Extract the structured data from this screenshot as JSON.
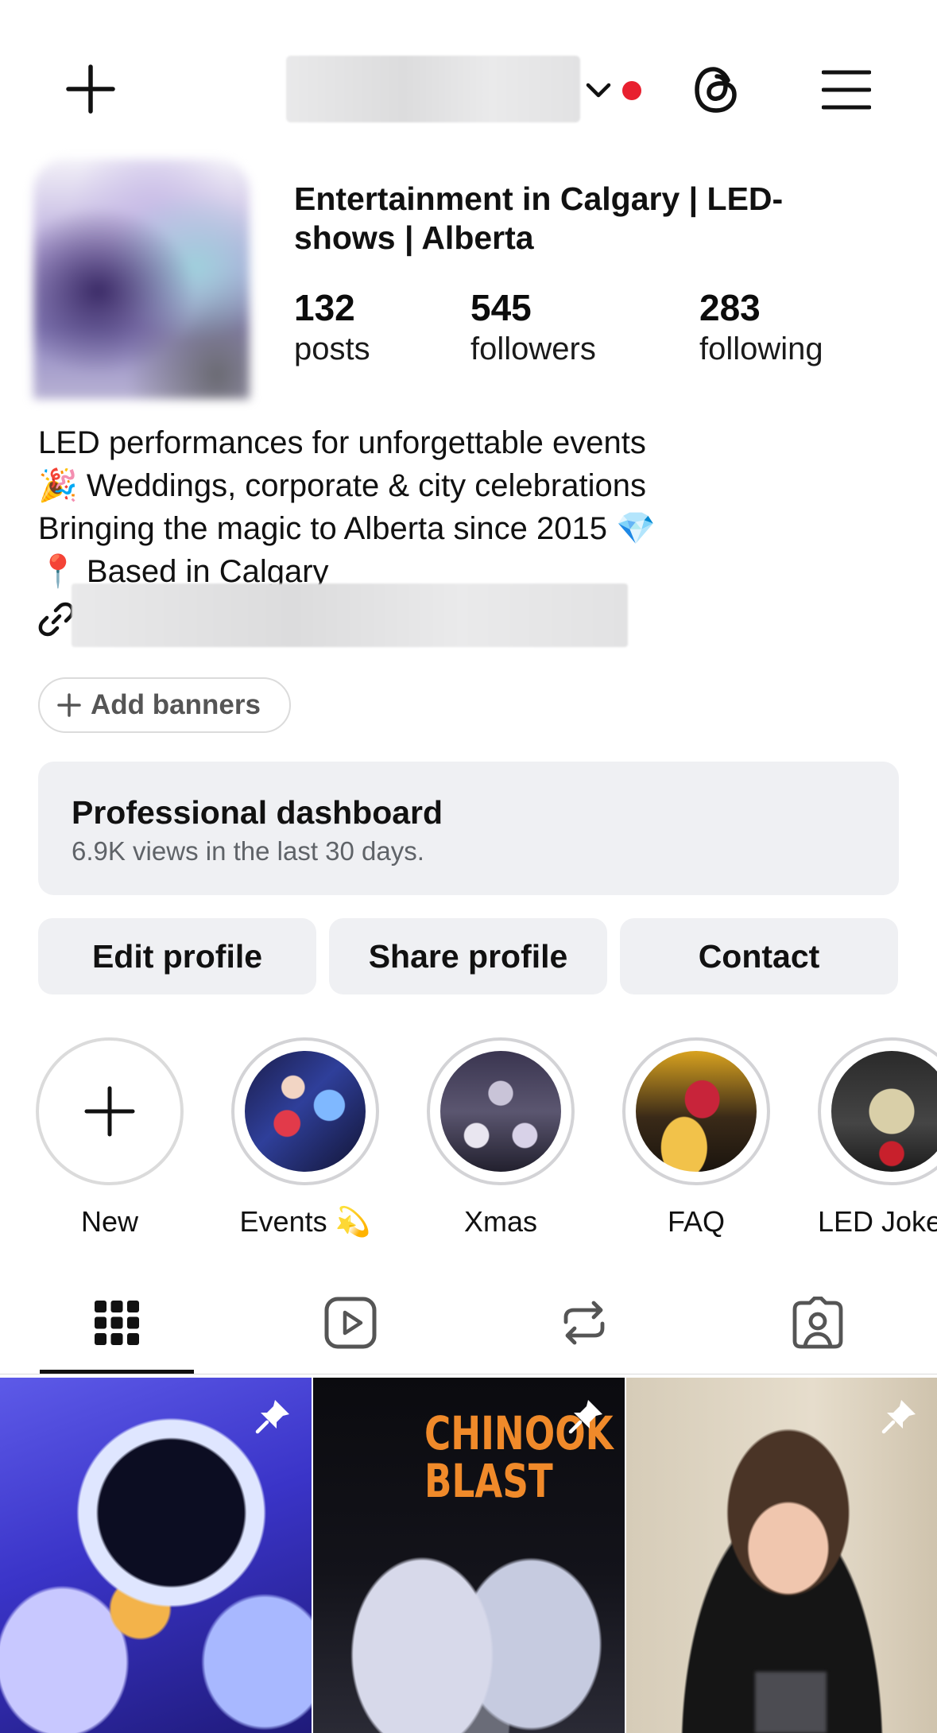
{
  "header": {
    "new_icon": "plus-icon",
    "account_switcher_icon": "chevron-down-icon",
    "threads_icon": "threads-icon",
    "menu_icon": "hamburger-menu-icon",
    "notification_dot_color": "#e8202f"
  },
  "profile": {
    "name": "Entertainment in Calgary | LED-shows | Alberta",
    "stats": [
      {
        "value": "132",
        "label": "posts"
      },
      {
        "value": "545",
        "label": "followers"
      },
      {
        "value": "283",
        "label": "following"
      }
    ],
    "bio": [
      "LED performances for unforgettable events",
      "🎉 Weddings, corporate & city celebrations",
      "Bringing the magic to Alberta since 2015 💎",
      "📍 Based in Calgary"
    ],
    "link_icon": "link-icon"
  },
  "add_banners": {
    "label": "Add banners",
    "icon": "plus-icon"
  },
  "dashboard": {
    "title": "Professional dashboard",
    "subtitle": "6.9K views in the last 30 days."
  },
  "actions": {
    "edit": "Edit profile",
    "share": "Share profile",
    "contact": "Contact"
  },
  "highlights": [
    {
      "label": "New",
      "icon": "plus-icon"
    },
    {
      "label": "Events 💫"
    },
    {
      "label": "Xmas"
    },
    {
      "label": "FAQ"
    },
    {
      "label": "LED Jokers"
    }
  ],
  "tabs": [
    {
      "icon": "grid-icon",
      "active": true
    },
    {
      "icon": "reels-icon"
    },
    {
      "icon": "reposts-icon"
    },
    {
      "icon": "tagged-icon"
    }
  ],
  "posts": [
    {
      "pinned": true,
      "pin_icon": "pin-icon"
    },
    {
      "pinned": true,
      "pin_icon": "pin-icon",
      "overlay_text": [
        "CHINOOK",
        "BLAST"
      ]
    },
    {
      "pinned": true,
      "pin_icon": "pin-icon"
    }
  ]
}
